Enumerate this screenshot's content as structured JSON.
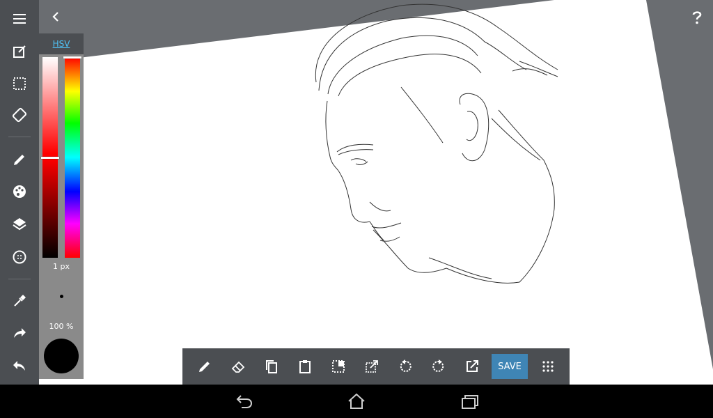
{
  "color_panel": {
    "mode_label": "HSV",
    "saturation_level": 0.5,
    "hue_level": 0.0,
    "brush_size": "1 px",
    "opacity": "100 %",
    "current_color": "#000000"
  },
  "bottom_toolbar": {
    "save_label": "SAVE"
  },
  "colors": {
    "toolbar_bg": "#4b4e52",
    "canvas_bg": "#6a6d71",
    "paper": "#ffffff",
    "accent": "#3f85b5",
    "link": "#4fc3f7"
  },
  "icons": {
    "left_toolbar": [
      "menu-icon",
      "edit-icon",
      "select-icon",
      "transform-icon",
      "pencil-icon",
      "palette-icon",
      "layers-icon",
      "dial-icon",
      "eyedropper-icon",
      "redo-icon",
      "undo-icon"
    ],
    "bottom_toolbar": [
      "pencil-icon",
      "eraser-icon",
      "copy-icon",
      "paste-icon",
      "select-icon",
      "transform-icon",
      "rotate-left-icon",
      "rotate-right-icon",
      "external-icon",
      "save-button",
      "grid-icon"
    ],
    "nav": [
      "back-icon",
      "home-icon",
      "recents-icon"
    ]
  }
}
